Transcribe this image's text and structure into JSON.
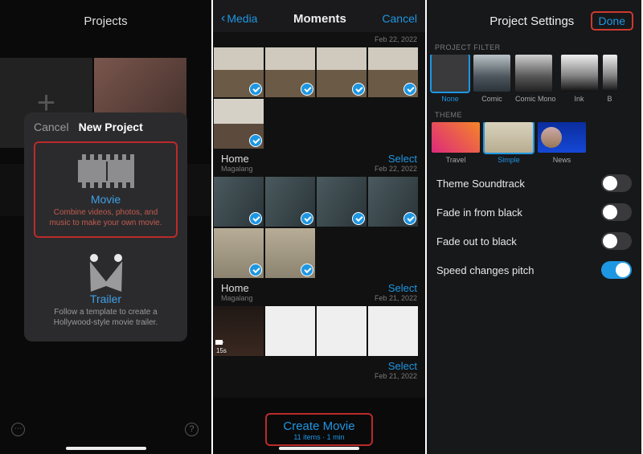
{
  "s1": {
    "header": "Projects",
    "modal": {
      "cancel": "Cancel",
      "title": "New Project",
      "movie": {
        "label": "Movie",
        "desc": "Combine videos, photos, and music to make your own movie."
      },
      "trailer": {
        "label": "Trailer",
        "desc": "Follow a template to create a Hollywood-style movie trailer."
      }
    },
    "help": "?",
    "menu": "⋯"
  },
  "s2": {
    "back": "Media",
    "title": "Moments",
    "cancel": "Cancel",
    "sections": [
      {
        "title": "",
        "sub": "",
        "date": "Feb 22, 2022",
        "select": ""
      },
      {
        "title": "Home",
        "sub": "Magalang",
        "date": "Feb 22, 2022",
        "select": "Select"
      },
      {
        "title": "Home",
        "sub": "Magalang",
        "date": "Feb 21, 2022",
        "select": "Select"
      },
      {
        "title": "",
        "sub": "",
        "date": "Feb 21, 2022",
        "select": "Select"
      }
    ],
    "video_dur": "15s",
    "create": {
      "label": "Create Movie",
      "sub": "11 items · 1 min"
    }
  },
  "s3": {
    "title": "Project Settings",
    "done": "Done",
    "filter_label": "PROJECT FILTER",
    "filters": [
      "None",
      "Comic",
      "Comic Mono",
      "Ink",
      "B"
    ],
    "theme_label": "THEME",
    "themes": [
      "Travel",
      "Simple",
      "News"
    ],
    "settings": [
      {
        "label": "Theme Soundtrack",
        "on": false
      },
      {
        "label": "Fade in from black",
        "on": false
      },
      {
        "label": "Fade out to black",
        "on": false
      },
      {
        "label": "Speed changes pitch",
        "on": true
      }
    ]
  }
}
